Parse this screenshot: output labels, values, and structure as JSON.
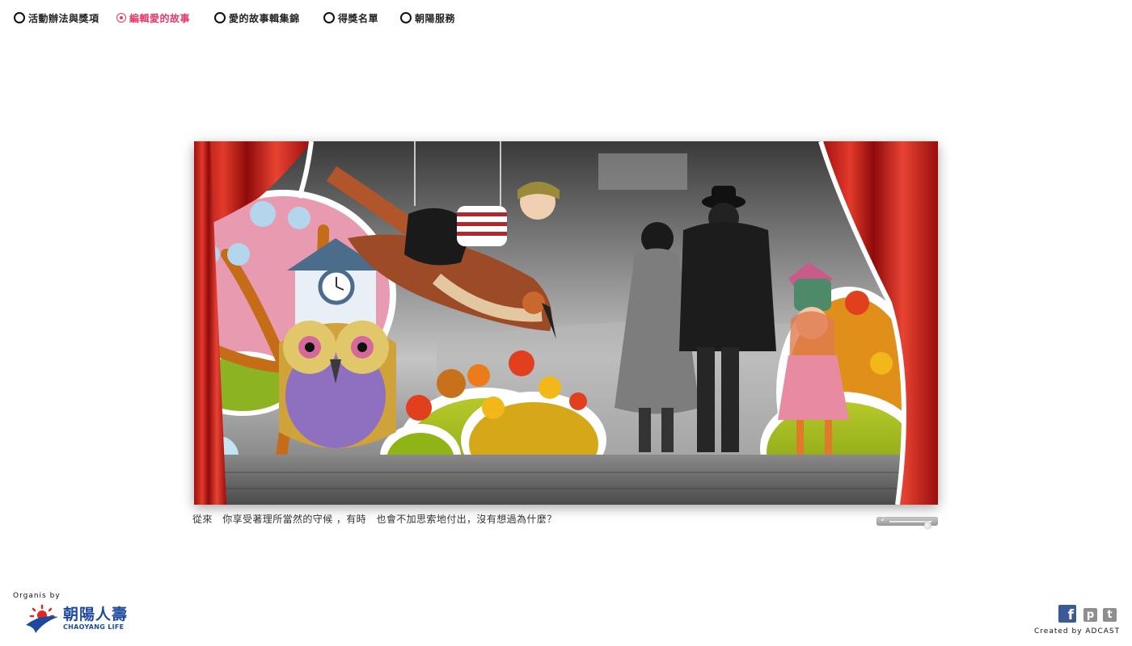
{
  "nav": {
    "items": [
      {
        "label": "活動辦法與獎項",
        "active": false
      },
      {
        "label": "編輯愛的故事",
        "active": true
      },
      {
        "label": "愛的故事輯集錦",
        "active": false
      },
      {
        "label": "得獎名單",
        "active": false
      },
      {
        "label": "朝陽服務",
        "active": false
      }
    ],
    "active_color": "#e9376a"
  },
  "stage": {
    "caption": "從來　你享受著理所當然的守候 ，有時　也會不加思索地付出，沒有想過為什麼？"
  },
  "volume": {
    "icon": "music-note-icon",
    "note_glyph": "♪",
    "level": 0.9
  },
  "footer": {
    "organis_label": "Organis by",
    "logo_cn": "朝陽人壽",
    "logo_en": "CHAOYANG LIFE",
    "brand_color": "#1d4aa0",
    "created_by": "Created by ADCAST",
    "social": {
      "facebook_glyph": "f",
      "plurk_glyph": "p",
      "twitter_glyph": "t"
    }
  }
}
